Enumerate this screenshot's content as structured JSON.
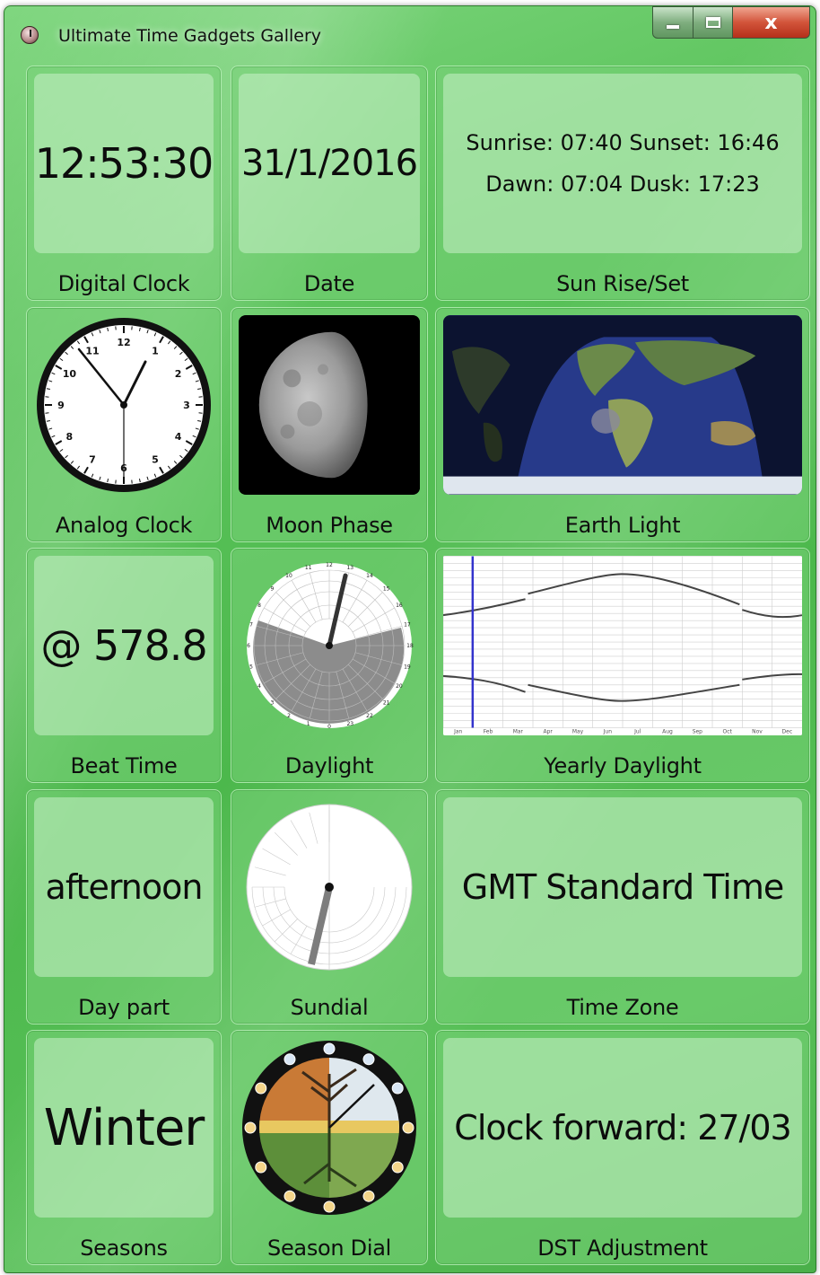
{
  "window": {
    "title": "Ultimate Time Gadgets Gallery",
    "close_glyph": "x"
  },
  "tiles": {
    "digital_clock": {
      "value": "12:53:30",
      "label": "Digital Clock"
    },
    "date": {
      "value": "31/1/2016",
      "label": "Date"
    },
    "sun": {
      "line1": "Sunrise: 07:40 Sunset: 16:46",
      "line2": "Dawn: 07:04 Dusk: 17:23",
      "label": "Sun Rise/Set"
    },
    "analog_clock": {
      "label": "Analog Clock",
      "numbers": [
        "12",
        "1",
        "2",
        "3",
        "4",
        "5",
        "6",
        "7",
        "8",
        "9",
        "10",
        "11"
      ]
    },
    "moon": {
      "label": "Moon Phase"
    },
    "earth": {
      "label": "Earth Light"
    },
    "beat": {
      "value": "@ 578.8",
      "label": "Beat Time"
    },
    "daylight": {
      "label": "Daylight",
      "hours": [
        "12",
        "13",
        "14",
        "15",
        "16",
        "17",
        "18",
        "19",
        "20",
        "21",
        "22",
        "23",
        "0",
        "1",
        "2",
        "3",
        "4",
        "5",
        "6",
        "7",
        "8",
        "9",
        "10",
        "11"
      ]
    },
    "yearly": {
      "label": "Yearly Daylight",
      "months": [
        "Jan",
        "Feb",
        "Mar",
        "Apr",
        "May",
        "Jun",
        "Jul",
        "Aug",
        "Sep",
        "Oct",
        "Nov",
        "Dec"
      ]
    },
    "day_part": {
      "value": "afternoon",
      "label": "Day part"
    },
    "sundial": {
      "label": "Sundial"
    },
    "time_zone": {
      "value": "GMT Standard Time",
      "label": "Time Zone"
    },
    "seasons": {
      "value": "Winter",
      "label": "Seasons"
    },
    "season_dial": {
      "label": "Season Dial"
    },
    "dst": {
      "value": "Clock forward: 27/03",
      "label": "DST Adjustment"
    }
  },
  "icons": {
    "app": "clock-app-icon",
    "minimize": "minimize-icon",
    "maximize": "maximize-icon",
    "close": "close-icon"
  },
  "colors": {
    "window_green": "#4cb84c",
    "close_red": "#d2543a",
    "night_grey": "#8c8c8c",
    "yearly_marker": "#3333cc"
  }
}
